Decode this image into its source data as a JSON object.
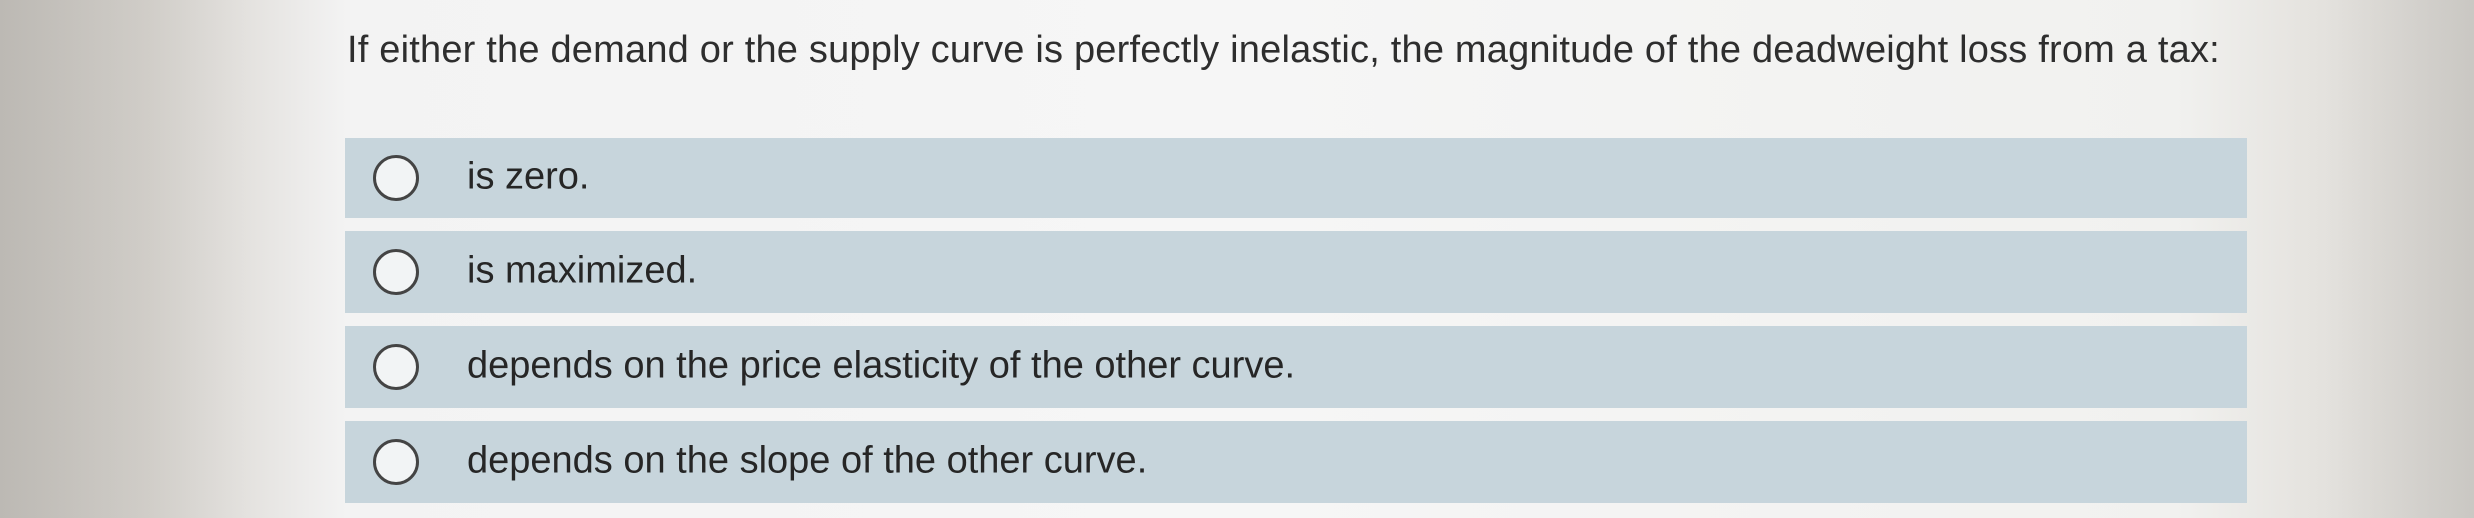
{
  "question": {
    "text": "If either the demand or the supply curve is perfectly inelastic, the magnitude of the deadweight loss from a tax:"
  },
  "options": [
    {
      "label": "is zero.",
      "selected": false
    },
    {
      "label": "is maximized.",
      "selected": false
    },
    {
      "label": "depends on the price elasticity of the other curve.",
      "selected": false
    },
    {
      "label": "depends on the slope of the other curve.",
      "selected": false
    }
  ],
  "colors": {
    "option_background": "#c7d5dc",
    "text": "#2e2e2e",
    "radio_border": "#444444"
  }
}
